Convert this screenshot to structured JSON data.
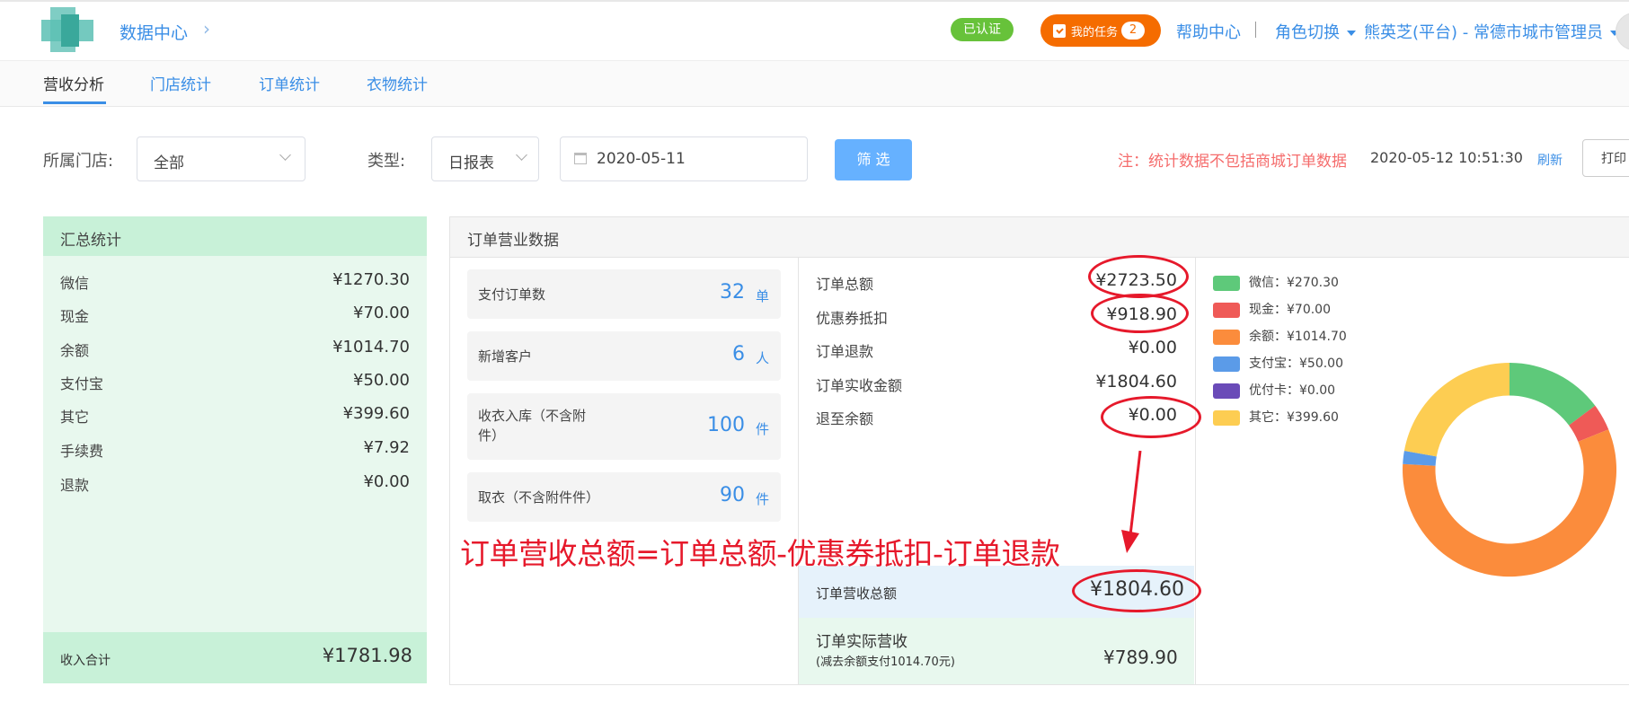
{
  "header": {
    "app_name": "数据中心",
    "verified_badge": "已认证",
    "my_tasks": {
      "label": "我的任务",
      "count": "2"
    },
    "help_center": "帮助中心",
    "role_switch": "角色切换",
    "user_label": "熊英芝(平台) - 常德市城市管理员"
  },
  "tabs": [
    {
      "label": "营收分析",
      "active": true
    },
    {
      "label": "门店统计",
      "active": false
    },
    {
      "label": "订单统计",
      "active": false
    },
    {
      "label": "衣物统计",
      "active": false
    }
  ],
  "filters": {
    "store_label": "所属门店:",
    "store_value": "全部",
    "type_label": "类型:",
    "type_value": "日报表",
    "date_value": "2020-05-11",
    "filter_button": "筛 选",
    "note": "注：统计数据不包括商城订单数据",
    "timestamp": "2020-05-12  10:51:30",
    "refresh": "刷新",
    "print": "打印"
  },
  "summary": {
    "title": "汇总统计",
    "rows": [
      {
        "label": "微信",
        "value": "¥1270.30"
      },
      {
        "label": "现金",
        "value": "¥70.00"
      },
      {
        "label": "余额",
        "value": "¥1014.70"
      },
      {
        "label": "支付宝",
        "value": "¥50.00"
      },
      {
        "label": "其它",
        "value": "¥399.60"
      },
      {
        "label": "手续费",
        "value": "¥7.92"
      },
      {
        "label": "退款",
        "value": "¥0.00"
      }
    ],
    "total_label": "收入合计",
    "total_value": "¥1781.98"
  },
  "orders": {
    "title": "订单营业数据",
    "stats": [
      {
        "label": "支付订单数",
        "value": "32",
        "unit": "单"
      },
      {
        "label": "新增客户",
        "value": "6",
        "unit": "人"
      },
      {
        "label": "收衣入库（不含附件）",
        "value": "100",
        "unit": "件"
      },
      {
        "label": "取衣（不含附件件）",
        "value": "90",
        "unit": "件"
      }
    ],
    "amounts": [
      {
        "label": "订单总额",
        "value": "¥2723.50"
      },
      {
        "label": "优惠券抵扣",
        "value": "¥918.90"
      },
      {
        "label": "订单退款",
        "value": "¥0.00"
      },
      {
        "label": "订单实收金额",
        "value": "¥1804.60"
      },
      {
        "label": "退至余额",
        "value": "¥0.00"
      }
    ],
    "revenue_total_label": "订单营收总额",
    "revenue_total_value": "¥1804.60",
    "actual_revenue_label": "订单实际营收",
    "actual_revenue_sub": "(减去余额支付1014.70元)",
    "actual_revenue_value": "¥789.90"
  },
  "legend": [
    {
      "label": "微信：¥270.30",
      "color": "#5ec97a"
    },
    {
      "label": "现金：¥70.00",
      "color": "#ef5a57"
    },
    {
      "label": "余额：¥1014.70",
      "color": "#fb8c3c"
    },
    {
      "label": "支付宝：¥50.00",
      "color": "#5b9be8"
    },
    {
      "label": "优付卡：¥0.00",
      "color": "#6a4bb8"
    },
    {
      "label": "其它：¥399.60",
      "color": "#fdcd52"
    }
  ],
  "annotation": "订单营收总额=订单总额-优惠券抵扣-订单退款"
}
